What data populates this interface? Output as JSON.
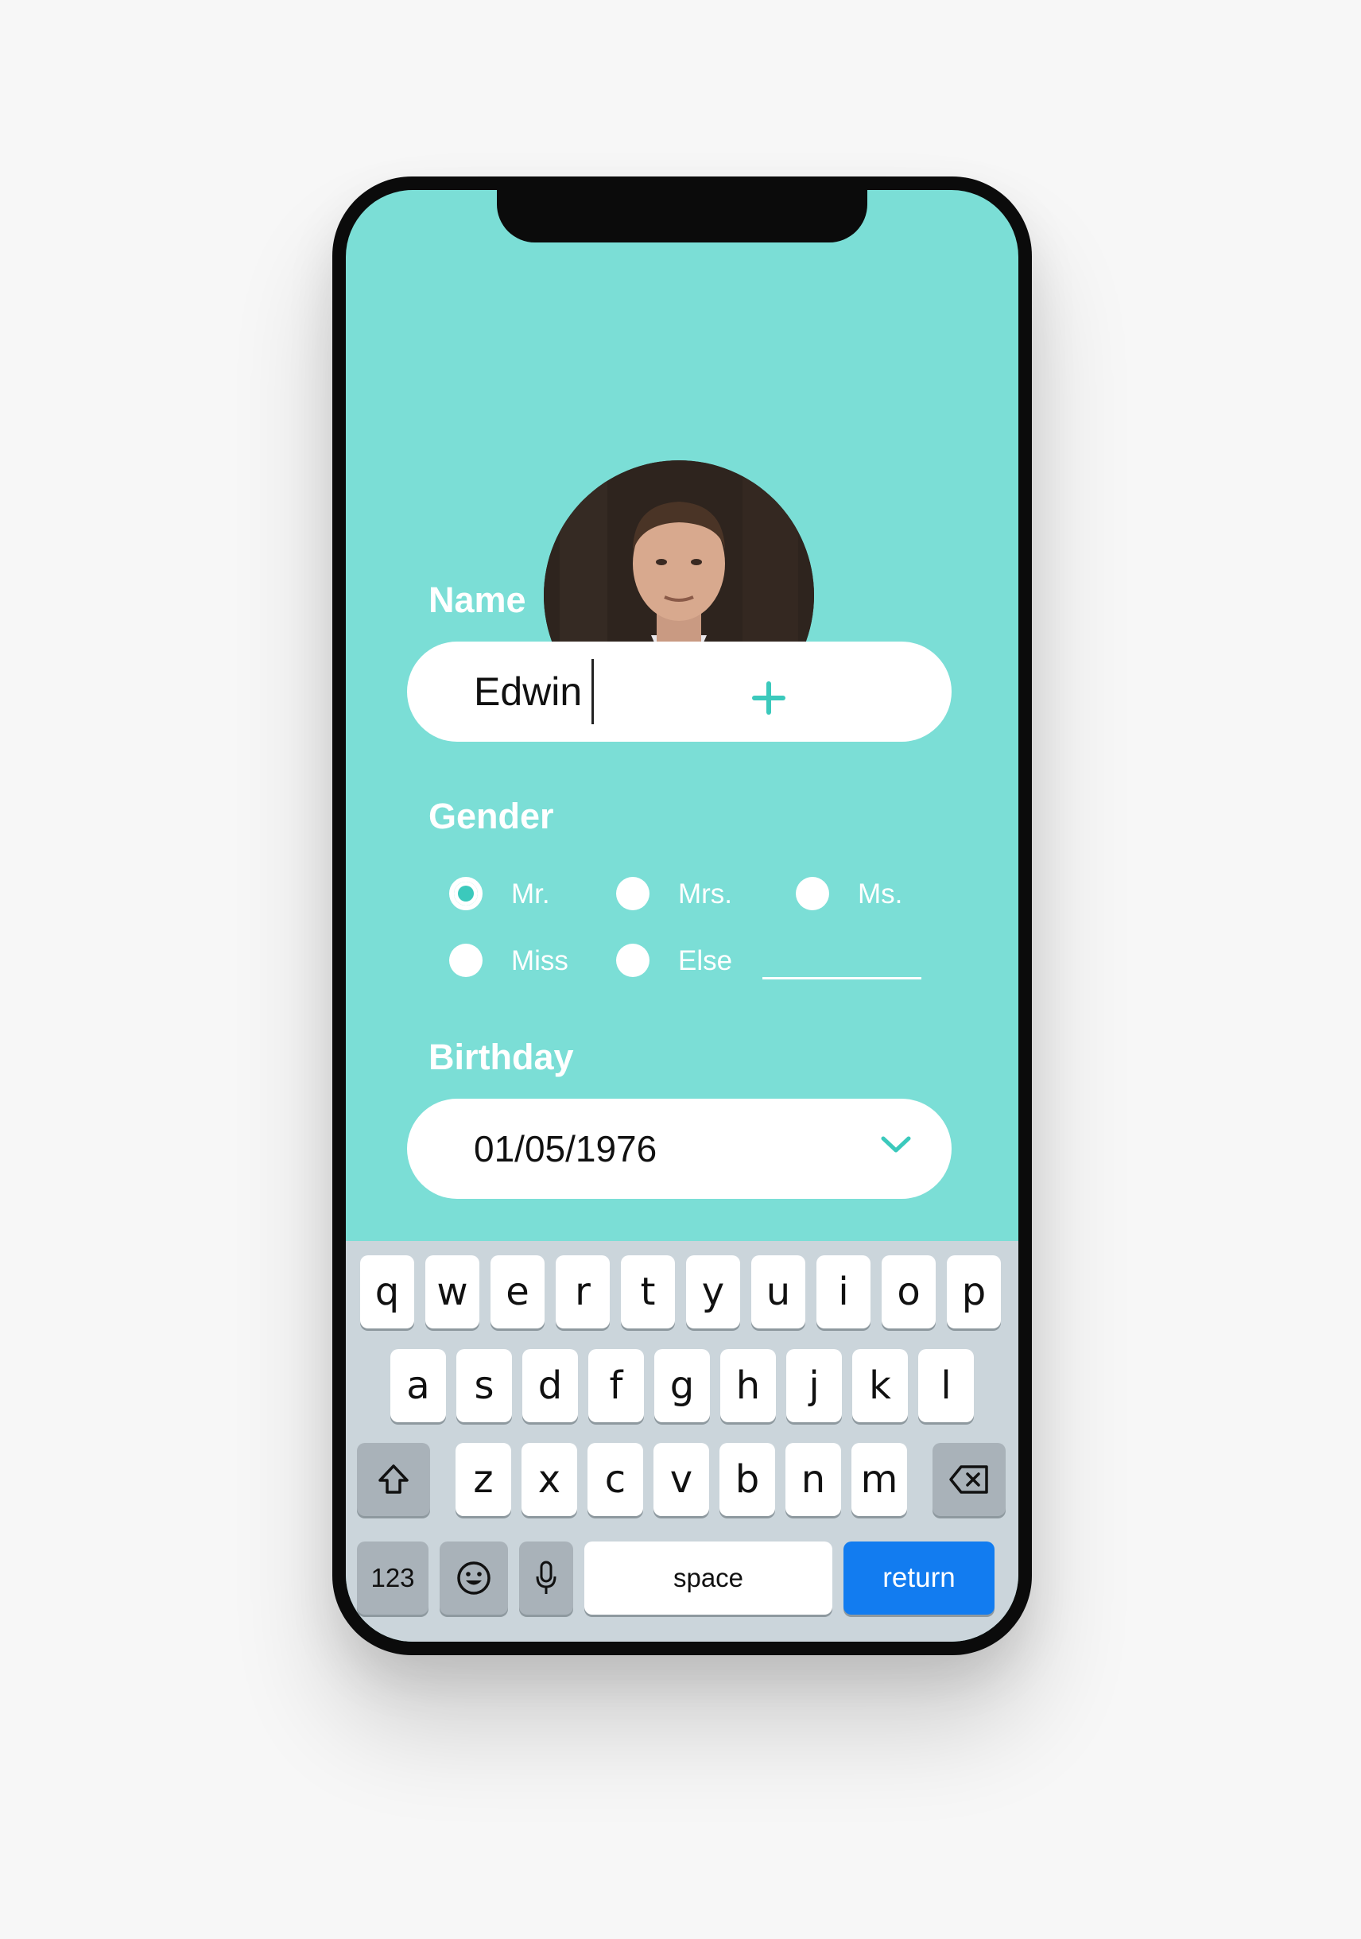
{
  "profile": {
    "add_photo_icon": "plus-icon"
  },
  "form": {
    "name_label": "Name",
    "name_value": "Edwin",
    "gender_label": "Gender",
    "gender_options": [
      "Mr.",
      "Mrs.",
      "Ms.",
      "Miss",
      "Else"
    ],
    "gender_selected": "Mr.",
    "birthday_label": "Birthday",
    "birthday_value": "01/05/1976"
  },
  "keyboard": {
    "row1": [
      "q",
      "w",
      "e",
      "r",
      "t",
      "y",
      "u",
      "i",
      "o",
      "p"
    ],
    "row2": [
      "a",
      "s",
      "d",
      "f",
      "g",
      "h",
      "j",
      "k",
      "l"
    ],
    "row3": [
      "z",
      "x",
      "c",
      "v",
      "b",
      "n",
      "m"
    ],
    "numbers_label": "123",
    "space_label": "space",
    "return_label": "return"
  },
  "colors": {
    "accent": "#7bded6",
    "radio_selected": "#3bc9bc",
    "return_key": "#127cf0",
    "keyboard_bg": "#cbd5db"
  }
}
